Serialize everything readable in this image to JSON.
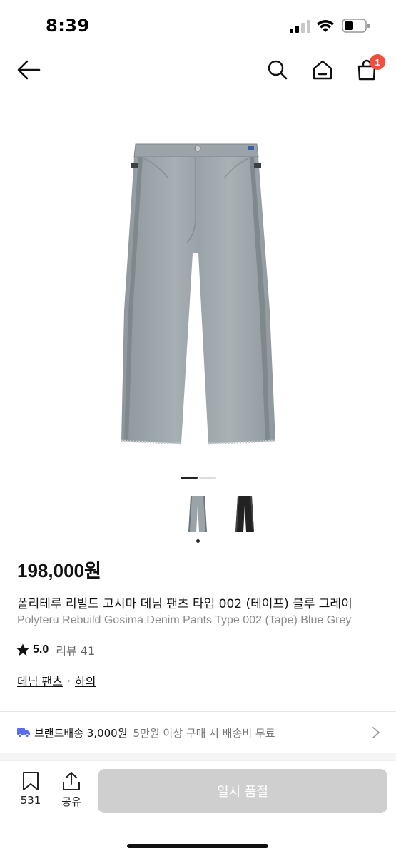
{
  "status_bar": {
    "time": "8:39",
    "icons": [
      "cellular-signal-icon",
      "wifi-icon",
      "battery-icon"
    ]
  },
  "nav": {
    "icons": [
      "back-arrow-icon",
      "search-icon",
      "home-icon",
      "shopping-bag-icon"
    ],
    "cart_badge": "1",
    "badge_color": "#f04e3e"
  },
  "product": {
    "image_icon": "denim-pants-image",
    "color_thumbnails": [
      "light-blue-grey-pants-thumb",
      "black-pants-thumb"
    ],
    "price": "198,000원",
    "title_ko": "폴리테루 리빌드 고시마 데님 팬츠 타입 002 (테이프) 블루 그레이",
    "title_en": "Polyteru Rebuild Gosima Denim Pants Type 002 (Tape) Blue Grey",
    "rating": "5.0",
    "review_label": "리뷰 41",
    "category": [
      "데님 팬츠",
      "하의"
    ],
    "category_separator": "·"
  },
  "shipping": {
    "title": "브랜드배송 3,000원",
    "desc": "5만원 이상 구매 시 배송비 무료",
    "truck_color": "#5b6cf0"
  },
  "bottom_bar": {
    "bookmark_count": "531",
    "share_label": "공유",
    "cta_label": "일시 품절",
    "cta_color": "#cfcfcf"
  }
}
